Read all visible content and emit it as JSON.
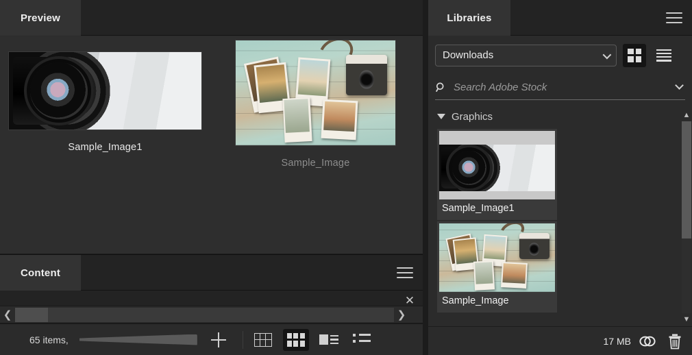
{
  "preview_panel": {
    "tab_label": "Preview",
    "items": [
      {
        "caption": "Sample_Image1",
        "art": "camera-lens",
        "selected": true
      },
      {
        "caption": "Sample_Image",
        "art": "polaroid-photos",
        "selected": false
      }
    ]
  },
  "content_panel": {
    "tab_label": "Content",
    "menu_icon": "hamburger-icon",
    "close_icon": "close-icon",
    "scroll_left_icon": "chevron-left-icon",
    "scroll_right_icon": "chevron-right-icon"
  },
  "statusbar": {
    "item_count": "65 items,",
    "slider_icon": "thumbnail-size-slider",
    "add_icon": "plus-icon",
    "view_modes": [
      {
        "name": "grid-lock-view",
        "icon": "grid-outline-icon",
        "active": false
      },
      {
        "name": "thumbnail-view",
        "icon": "tiles-icon",
        "active": true
      },
      {
        "name": "details-view",
        "icon": "details-icon",
        "active": false
      },
      {
        "name": "list-view",
        "icon": "list-icon",
        "active": false
      }
    ]
  },
  "libraries_panel": {
    "tab_label": "Libraries",
    "menu_icon": "hamburger-icon",
    "library_select": {
      "value": "Downloads",
      "chevron_icon": "chevron-down-icon"
    },
    "view_toggles": [
      {
        "name": "grid-view",
        "icon": "quad-grid-icon",
        "active": true
      },
      {
        "name": "list-view",
        "icon": "rows-icon",
        "active": false
      }
    ],
    "search": {
      "placeholder": "Search Adobe Stock",
      "search_icon": "search-icon",
      "chevron_icon": "chevron-down-icon"
    },
    "group": {
      "label": "Graphics",
      "expanded": true,
      "triangle_icon": "triangle-down-icon"
    },
    "assets": [
      {
        "name": "Sample_Image1",
        "art": "camera-lens"
      },
      {
        "name": "Sample_Image",
        "art": "polaroid-photos"
      }
    ],
    "scrollbar": {
      "up_icon": "chevron-up-icon",
      "down_icon": "chevron-down-icon"
    },
    "footer": {
      "size_label": "17 MB",
      "cloud_icon": "creative-cloud-icon",
      "delete_icon": "trash-icon"
    }
  },
  "colors": {
    "panel_bg": "#2b2b2b",
    "tabbar_bg": "#232323",
    "tab_active_bg": "#333333",
    "text": "#eeeeee",
    "text_dim": "#8d8d8d",
    "accent_border": "#585858"
  }
}
